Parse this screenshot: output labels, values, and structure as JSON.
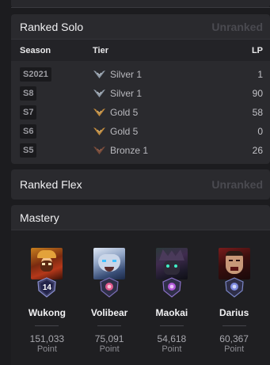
{
  "ranked_solo": {
    "title": "Ranked Solo",
    "status": "Unranked",
    "headers": {
      "season": "Season",
      "tier": "Tier",
      "lp": "LP"
    },
    "rows": [
      {
        "season": "S2021",
        "tier": "Silver 1",
        "lp": "1",
        "tier_icon": "silver-emblem-icon"
      },
      {
        "season": "S8",
        "tier": "Silver 1",
        "lp": "90",
        "tier_icon": "silver-emblem-icon"
      },
      {
        "season": "S7",
        "tier": "Gold 5",
        "lp": "58",
        "tier_icon": "gold-emblem-icon"
      },
      {
        "season": "S6",
        "tier": "Gold 5",
        "lp": "0",
        "tier_icon": "gold-emblem-icon"
      },
      {
        "season": "S5",
        "tier": "Bronze 1",
        "lp": "26",
        "tier_icon": "bronze-emblem-icon"
      }
    ],
    "tier_colors": {
      "silver": "#9aa7b4",
      "gold": "#c08a3e",
      "bronze": "#8a5a44"
    }
  },
  "ranked_flex": {
    "title": "Ranked Flex",
    "status": "Unranked"
  },
  "mastery": {
    "title": "Mastery",
    "champions": [
      {
        "name": "Wukong",
        "points": "151,033",
        "points_label": "Point",
        "level": "14",
        "emblem": "mastery-emblem-level-14-icon"
      },
      {
        "name": "Volibear",
        "points": "75,091",
        "points_label": "Point",
        "level": "",
        "emblem": "mastery-emblem-icon"
      },
      {
        "name": "Maokai",
        "points": "54,618",
        "points_label": "Point",
        "level": "",
        "emblem": "mastery-emblem-icon"
      },
      {
        "name": "Darius",
        "points": "60,367",
        "points_label": "Point",
        "level": "",
        "emblem": "mastery-emblem-icon"
      }
    ]
  }
}
